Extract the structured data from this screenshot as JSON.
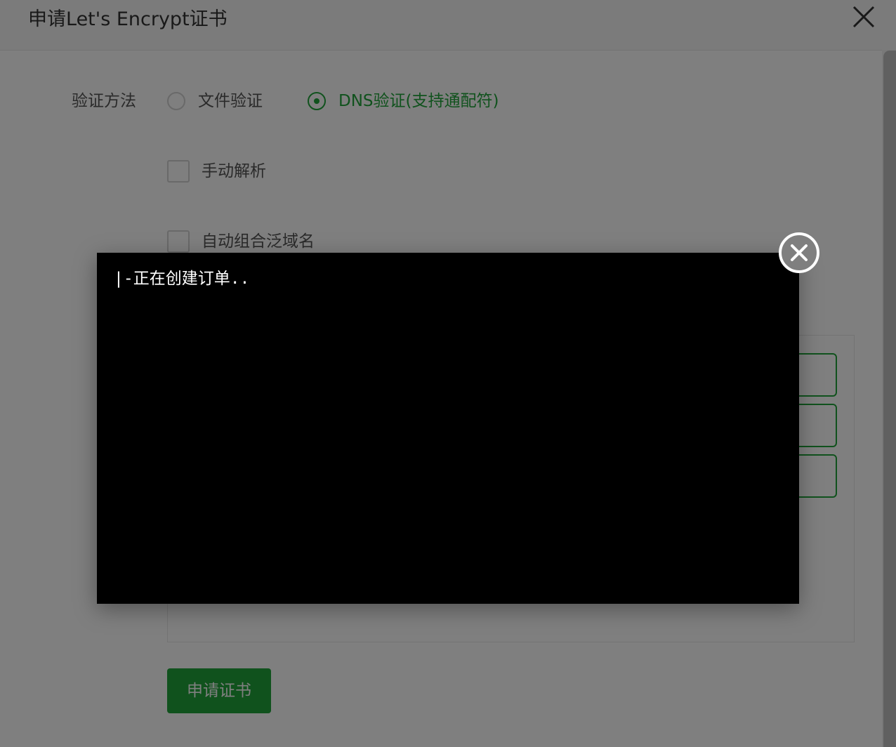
{
  "dialog": {
    "title": "申请Let's Encrypt证书",
    "close_icon": "close-x-icon"
  },
  "form": {
    "verify_method_label": "验证方法",
    "options": [
      {
        "label": "文件验证",
        "checked": false
      },
      {
        "label": "DNS验证(支持通配符)",
        "checked": true
      }
    ],
    "manual_resolve_label": "手动解析",
    "auto_wildcard_label": "自动组合泛域名",
    "apply_button_label": "申请证书"
  },
  "console": {
    "log_line": "|-正在创建订单..",
    "close_icon": "circle-close-icon"
  },
  "colors": {
    "accent": "#20a53a",
    "console_bg": "#000000",
    "console_text": "#ffffff"
  }
}
